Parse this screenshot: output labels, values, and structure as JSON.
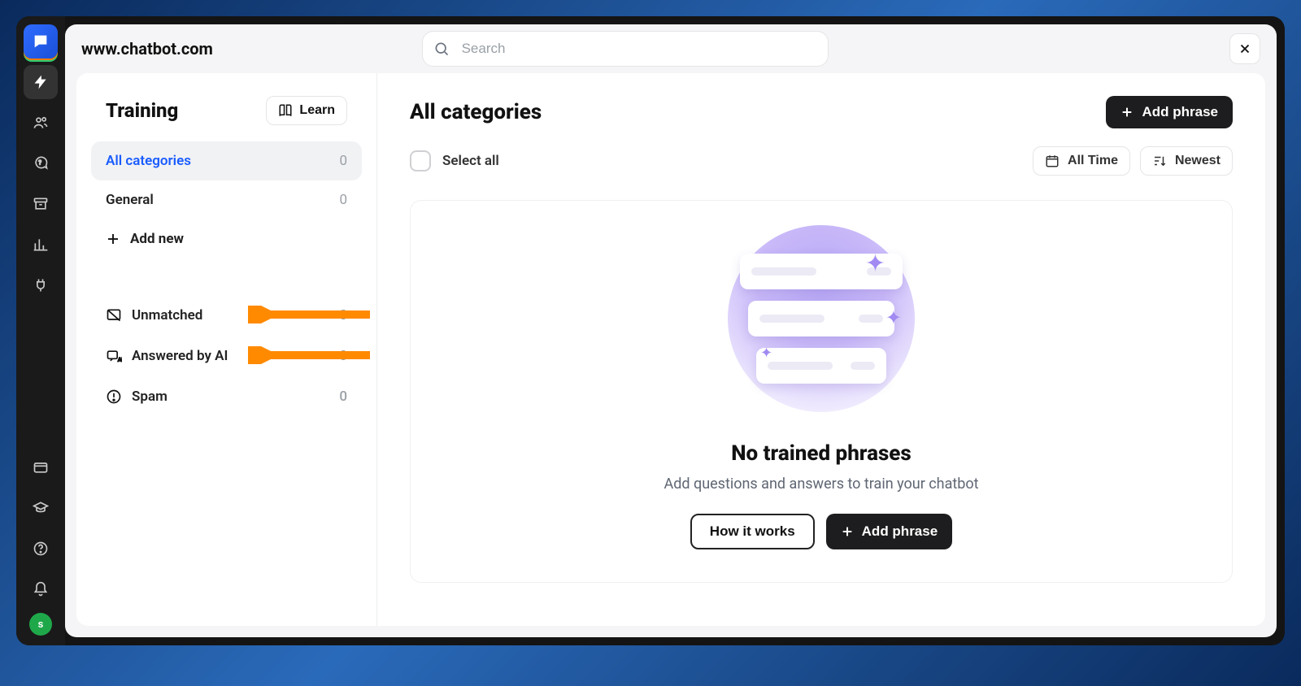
{
  "breadcrumb": "www.chatbot.com",
  "search": {
    "placeholder": "Search"
  },
  "leftbar": {
    "avatar_initial": "s"
  },
  "sidebar": {
    "title": "Training",
    "learn_label": "Learn",
    "categories": [
      {
        "label": "All categories",
        "count": "0",
        "active": true
      },
      {
        "label": "General",
        "count": "0",
        "active": false
      }
    ],
    "add_new_label": "Add new",
    "sections": [
      {
        "label": "Unmatched",
        "count": "0"
      },
      {
        "label": "Answered by AI",
        "count": "0"
      },
      {
        "label": "Spam",
        "count": "0"
      }
    ]
  },
  "panel": {
    "title": "All categories",
    "add_phrase_label": "Add phrase",
    "select_all_label": "Select all",
    "filter_time": "All Time",
    "filter_sort": "Newest",
    "empty_title": "No trained phrases",
    "empty_subtitle": "Add questions and answers to train your chatbot",
    "how_it_works_label": "How it works",
    "empty_add_phrase_label": "Add phrase"
  }
}
